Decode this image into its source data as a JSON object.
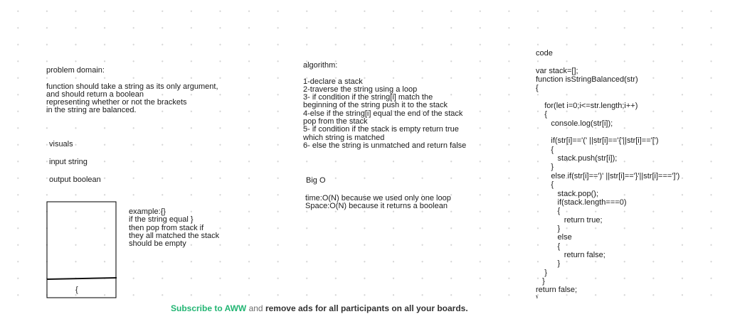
{
  "board": {
    "problem_domain": [
      "problem domain:",
      "",
      "function should take a string as its only argument,",
      "and should return a boolean",
      "representing whether or not the brackets",
      "in the string are balanced."
    ],
    "visuals": "visuals",
    "input": "input string",
    "output": "output boolean",
    "example": [
      "example:{}",
      "if the string equal }",
      "then pop from stack if",
      "they all matched the stack",
      "should be empty"
    ],
    "box_char": "{",
    "algorithm": [
      "algorithm:",
      "",
      "1-declare a stack",
      "2-traverse the string using a loop",
      "3- if condition if the string[i] match the",
      "beginning of the string push it to the stack",
      "4-else if the string[i] equal the end of the stack",
      "pop from the stack",
      "5- if condition if the stack is empty return true",
      "which string is matched",
      "6- else the string is unmatched and return false"
    ],
    "big_o": "Big O",
    "complexity": [
      "time:O(N) because we used only one loop",
      "Space:O(N) because it returns a boolean"
    ],
    "code": [
      "code",
      "",
      "var stack=[];",
      "function isStringBalanced(str)",
      "{",
      "",
      "    for(let i=0;i<=str.length;i++)",
      "    {",
      "       console.log(str[i]);",
      "",
      "       if(str[i]=='(' ||str[i]=='{'||str[i]=='[')",
      "       {",
      "          stack.push(str[i]);",
      "       }",
      "       else if(str[i]==')' ||str[i]=='}'||str[i]===']')",
      "       {",
      "          stack.pop();",
      "          if(stack.length===0)",
      "          {",
      "             return true;",
      "          }",
      "          else",
      "          {",
      "             return false;",
      "          }",
      "    }",
      "   }",
      "return false;",
      "}"
    ]
  },
  "banner": {
    "link": "Subscribe to AWW",
    "middle": " and ",
    "rest": "remove ads for all participants on all your boards."
  }
}
